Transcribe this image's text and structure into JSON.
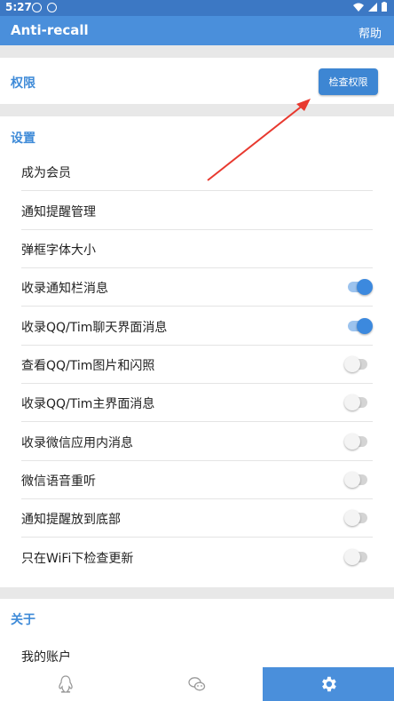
{
  "status_bar": {
    "time": "5:27"
  },
  "app_bar": {
    "title": "Anti-recall",
    "help": "帮助"
  },
  "permissions": {
    "title": "权限",
    "check_button": "检查权限"
  },
  "settings": {
    "title": "设置",
    "items": [
      {
        "label": "成为会员"
      },
      {
        "label": "通知提醒管理"
      },
      {
        "label": "弹框字体大小"
      },
      {
        "label": "收录通知栏消息",
        "toggle": true
      },
      {
        "label": "收录QQ/Tim聊天界面消息",
        "toggle": true
      },
      {
        "label": "查看QQ/Tim图片和闪照",
        "toggle": false
      },
      {
        "label": "收录QQ/Tim主界面消息",
        "toggle": false
      },
      {
        "label": "收录微信应用内消息",
        "toggle": false
      },
      {
        "label": "微信语音重听",
        "toggle": false
      },
      {
        "label": "通知提醒放到底部",
        "toggle": false
      },
      {
        "label": "只在WiFi下检查更新",
        "toggle": false
      }
    ]
  },
  "about": {
    "title": "关于",
    "items": [
      {
        "label": "我的账户"
      }
    ]
  },
  "bottom_nav": [
    {
      "icon": "qq-penguin-icon",
      "active": false
    },
    {
      "icon": "wechat-icon",
      "active": false
    },
    {
      "icon": "gear-icon",
      "active": true
    }
  ],
  "colors": {
    "primary": "#4a8fdb",
    "accent": "#3c89de",
    "section_title": "#3f8bd8",
    "annotation_arrow": "#e8392f"
  }
}
